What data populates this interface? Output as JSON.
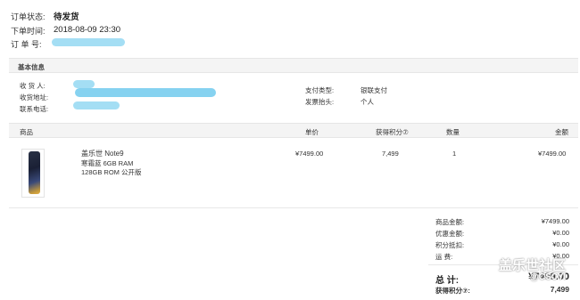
{
  "header": {
    "status_label": "订单状态:",
    "status_value": "待发货",
    "time_label": "下单时间:",
    "time_value": "2018-08-09 23:30",
    "order_no_label": "订 单 号:"
  },
  "basic_info": {
    "section_title": "基本信息",
    "receiver_label": "收 货 人:",
    "address_label": "收货地址:",
    "phone_label": "联系电话:",
    "pay_type_label": "支付类型:",
    "pay_type_value": "银联支付",
    "invoice_label": "发票抬头:",
    "invoice_value": "个人"
  },
  "products": {
    "columns": {
      "product": "商品",
      "unit_price": "单价",
      "points": "获得积分⑦",
      "quantity": "数量",
      "amount": "金额"
    },
    "items": [
      {
        "name": "盖乐世 Note9",
        "spec1": "寒霜蓝   6GB RAM",
        "spec2": "128GB ROM   公开版",
        "unit_price": "¥7499.00",
        "points": "7,499",
        "quantity": "1",
        "amount": "¥7499.00"
      }
    ]
  },
  "summary": {
    "goods_amount_label": "商品金额:",
    "goods_amount_value": "¥7499.00",
    "discount_label": "优惠金额:",
    "discount_value": "¥0.00",
    "points_deduct_label": "积分抵扣:",
    "points_deduct_value": "¥0.00",
    "shipping_label": "运      费:",
    "shipping_value": "¥0.00",
    "total_label": "总   计:",
    "total_value": "¥7499.00",
    "earned_points_label": "获得积分⑦:",
    "earned_points_value": "7,499"
  },
  "watermark": {
    "line1": "盖乐世社区",
    "line2": "@CSCYI"
  }
}
